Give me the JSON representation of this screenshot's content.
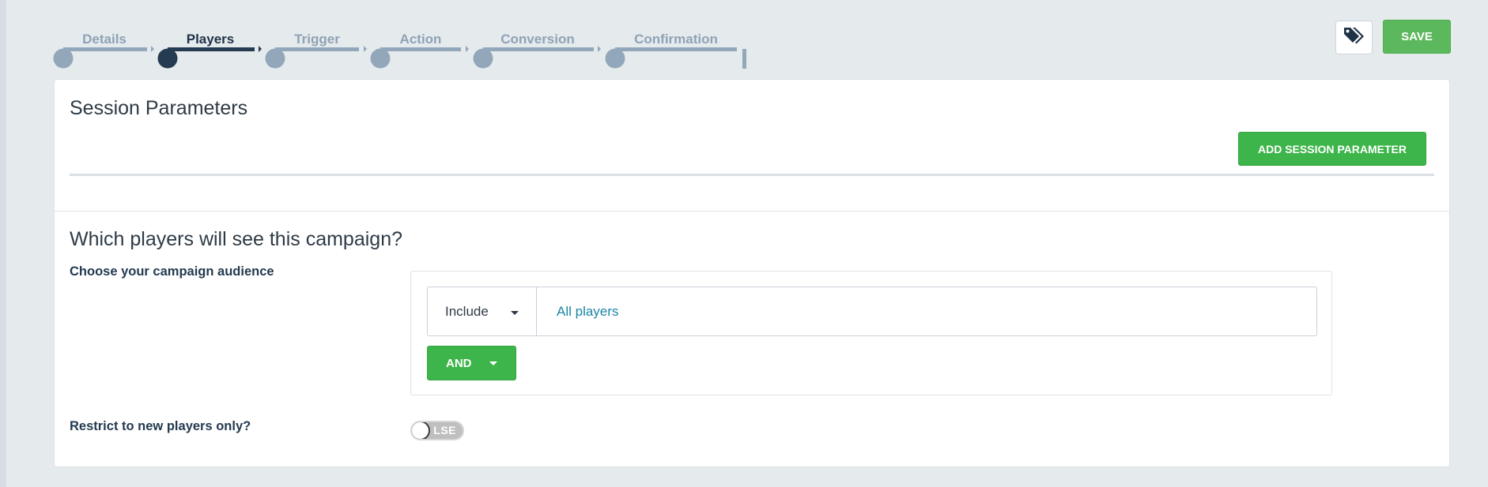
{
  "stepper": {
    "steps": [
      {
        "label": "Details",
        "state": "done"
      },
      {
        "label": "Players",
        "state": "active"
      },
      {
        "label": "Trigger",
        "state": "pending"
      },
      {
        "label": "Action",
        "state": "pending"
      },
      {
        "label": "Conversion",
        "state": "pending"
      },
      {
        "label": "Confirmation",
        "state": "pending"
      }
    ]
  },
  "toolbar": {
    "tag_icon": "tag-icon",
    "save_label": "SAVE"
  },
  "session_parameters": {
    "title": "Session Parameters",
    "add_button_label": "ADD SESSION PARAMETER"
  },
  "players": {
    "title": "Which players will see this campaign?",
    "audience_label": "Choose your campaign audience",
    "rule": {
      "mode": "Include",
      "value": "All players"
    },
    "and_button_label": "AND",
    "restrict_label": "Restrict to new players only?",
    "restrict_toggle": {
      "state": "off",
      "text": "LSE"
    }
  },
  "colors": {
    "accent_green": "#3db54a",
    "save_green": "#5cb85c",
    "link_blue": "#1a86a6",
    "step_active": "#253b51",
    "step_inactive": "#93a7bb"
  }
}
